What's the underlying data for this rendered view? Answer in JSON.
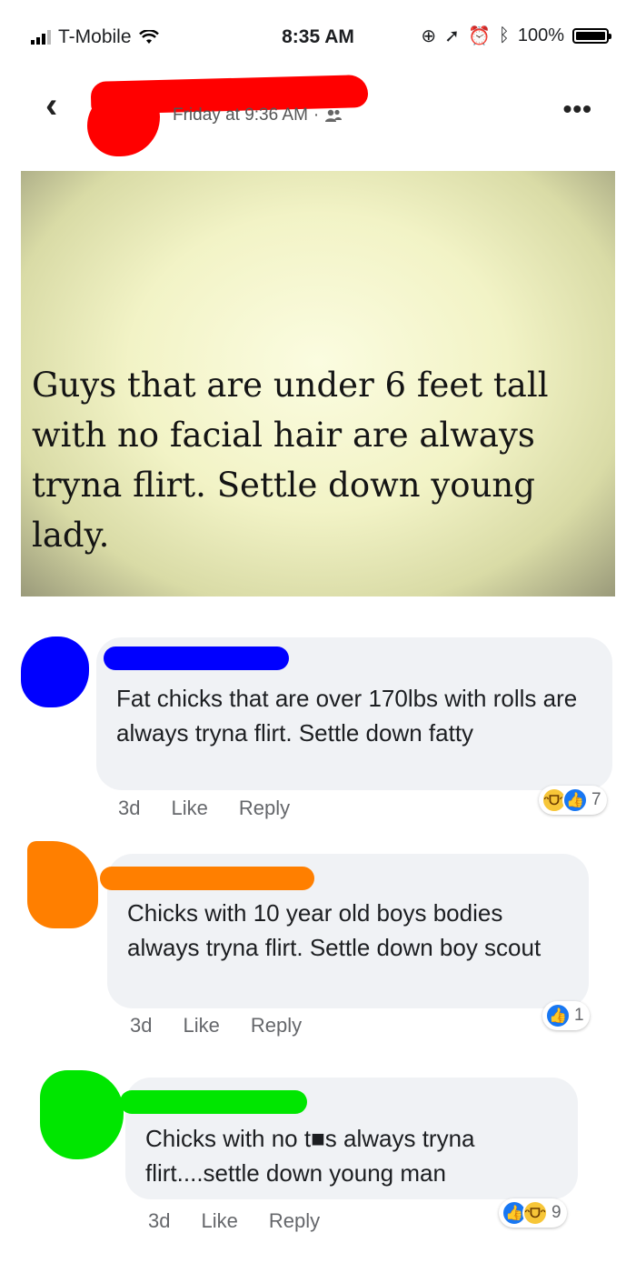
{
  "status_bar": {
    "carrier": "T-Mobile",
    "time": "8:35 AM",
    "battery": "100%",
    "icons": [
      "signal-icon",
      "wifi-icon",
      "lock-rotation-icon",
      "location-icon",
      "alarm-icon",
      "bluetooth-icon",
      "battery-icon"
    ]
  },
  "post": {
    "timestamp": "Friday at 9:36 AM",
    "separator": "·",
    "audience_icon": "friends-icon",
    "meme_text": "Guys that are under 6 feet tall with no facial hair are always tryna flirt. Settle down young lady."
  },
  "comments": [
    {
      "text": "Fat chicks that are over 170lbs with rolls are always tryna flirt. Settle down fatty",
      "age": "3d",
      "like_label": "Like",
      "reply_label": "Reply",
      "reactions": [
        "haha",
        "like"
      ],
      "reaction_count": "7",
      "redact_color": "#0000ff"
    },
    {
      "text": "Chicks with 10 year old boys bodies always tryna flirt. Settle down boy scout",
      "age": "3d",
      "like_label": "Like",
      "reply_label": "Reply",
      "reactions": [
        "like"
      ],
      "reaction_count": "1",
      "redact_color": "#ff7f00"
    },
    {
      "text": "Chicks with no t■s always tryna flirt....settle down young man",
      "age": "3d",
      "like_label": "Like",
      "reply_label": "Reply",
      "reactions": [
        "like",
        "haha"
      ],
      "reaction_count": "9",
      "redact_color": "#00e600"
    }
  ],
  "colors": {
    "accent": "#1877f2",
    "bubble": "#f0f2f5",
    "redact_header": "#ff0000"
  }
}
